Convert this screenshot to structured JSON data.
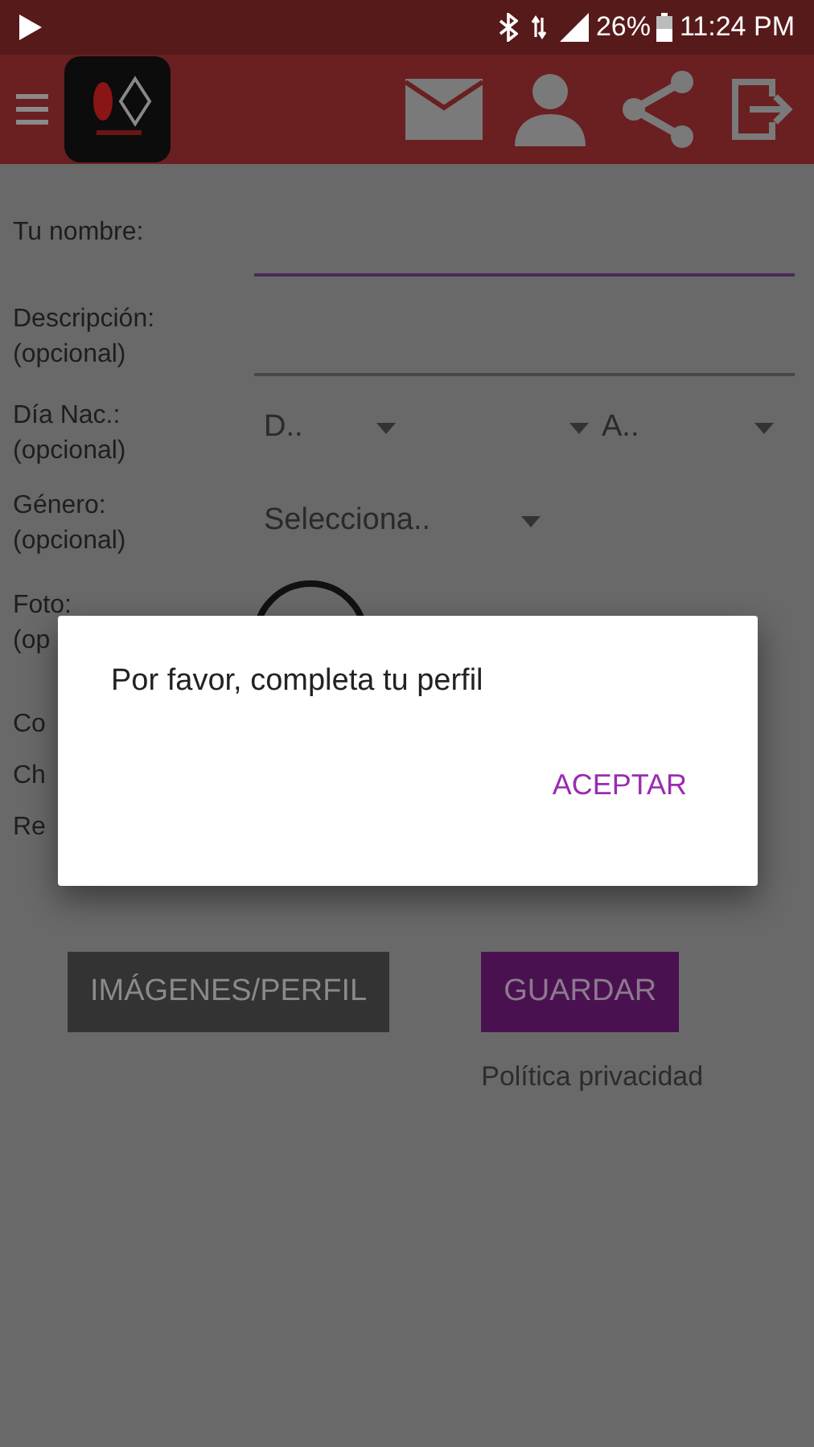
{
  "status_bar": {
    "battery": "26%",
    "time": "11:24 PM"
  },
  "form": {
    "fields": [
      {
        "kind": "text",
        "label": "Tu nombre:",
        "focused": true
      },
      {
        "kind": "text",
        "label": "Descripción:",
        "note": "(opcional)",
        "focused": false
      },
      {
        "kind": "date",
        "label": "Día Nac.:",
        "note": "(opcional)",
        "selects": [
          {
            "kind": "text",
            "text": "D.."
          },
          {
            "kind": "empty"
          },
          {
            "kind": "text",
            "text": "A.."
          }
        ]
      },
      {
        "kind": "select",
        "label": "Género:",
        "note": "(opcional)",
        "selects": [
          {
            "kind": "text",
            "text": "Selecciona.."
          }
        ]
      },
      {
        "kind": "photo",
        "label": "Foto:",
        "note": "(op"
      }
    ],
    "hidden_labels": [
      "Co",
      "Ch",
      "Re"
    ],
    "buttons": [
      {
        "label": "IMÁGENES/PERFIL",
        "primary": false
      },
      {
        "label": "GUARDAR",
        "primary": true
      }
    ],
    "privacy_link": "Política privacidad"
  },
  "dialog": {
    "message": "Por favor, completa tu perfil",
    "action": "ACEPTAR"
  }
}
